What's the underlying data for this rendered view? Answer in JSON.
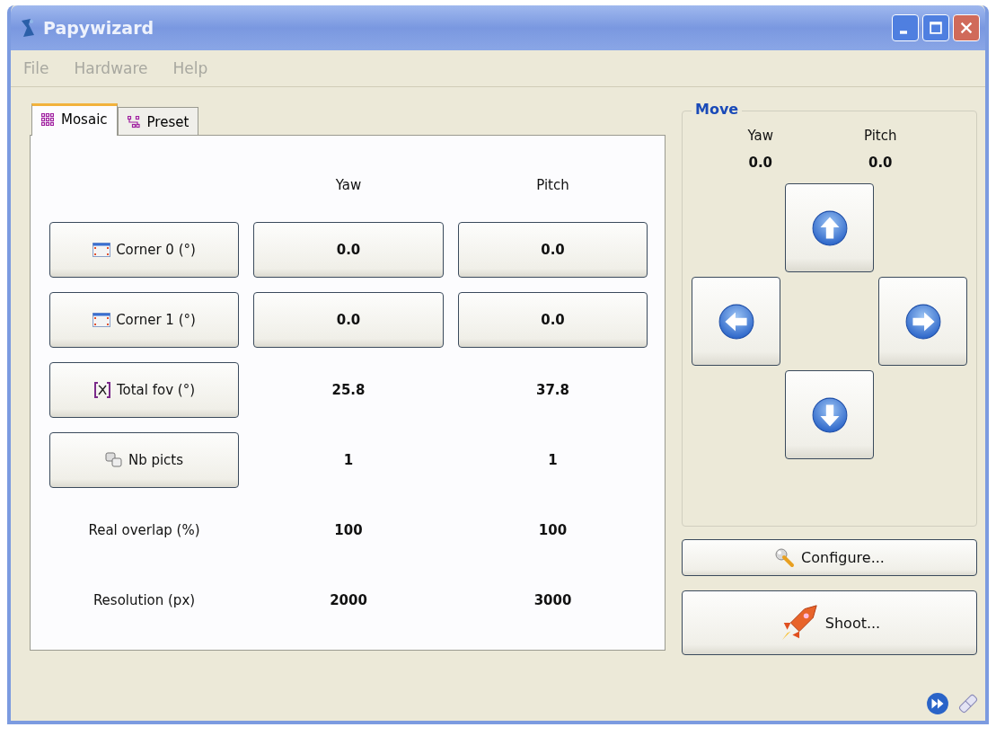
{
  "window": {
    "title": "Papywizard"
  },
  "menu": [
    {
      "label": "File",
      "disabled": true
    },
    {
      "label": "Hardware",
      "disabled": true
    },
    {
      "label": "Help",
      "disabled": true
    }
  ],
  "tabs": [
    {
      "label": "Mosaic",
      "selected": true
    },
    {
      "label": "Preset",
      "selected": false
    }
  ],
  "table": {
    "columns": [
      "Yaw",
      "Pitch"
    ],
    "rows": [
      {
        "kind": "button",
        "label": "Corner 0 (°)",
        "cells": [
          {
            "kind": "field",
            "value": "0.0"
          },
          {
            "kind": "field",
            "value": "0.0"
          }
        ]
      },
      {
        "kind": "button",
        "label": "Corner 1 (°)",
        "cells": [
          {
            "kind": "field",
            "value": "0.0"
          },
          {
            "kind": "field",
            "value": "0.0"
          }
        ]
      },
      {
        "kind": "button",
        "label": "Total fov (°)",
        "cells": [
          {
            "kind": "text",
            "value": "25.8"
          },
          {
            "kind": "text",
            "value": "37.8"
          }
        ]
      },
      {
        "kind": "button",
        "label": "Nb picts",
        "cells": [
          {
            "kind": "text",
            "value": "1"
          },
          {
            "kind": "text",
            "value": "1"
          }
        ]
      },
      {
        "kind": "text",
        "label": "Real overlap (%)",
        "cells": [
          {
            "kind": "text",
            "value": "100"
          },
          {
            "kind": "text",
            "value": "100"
          }
        ]
      },
      {
        "kind": "text",
        "label": "Resolution (px)",
        "cells": [
          {
            "kind": "text",
            "value": "2000"
          },
          {
            "kind": "text",
            "value": "3000"
          }
        ]
      }
    ]
  },
  "move": {
    "title": "Move",
    "columns": [
      {
        "label": "Yaw",
        "value": "0.0"
      },
      {
        "label": "Pitch",
        "value": "0.0"
      }
    ]
  },
  "buttons": [
    {
      "kind": "configure",
      "label": "Configure..."
    },
    {
      "kind": "shoot",
      "label": "Shoot..."
    }
  ]
}
